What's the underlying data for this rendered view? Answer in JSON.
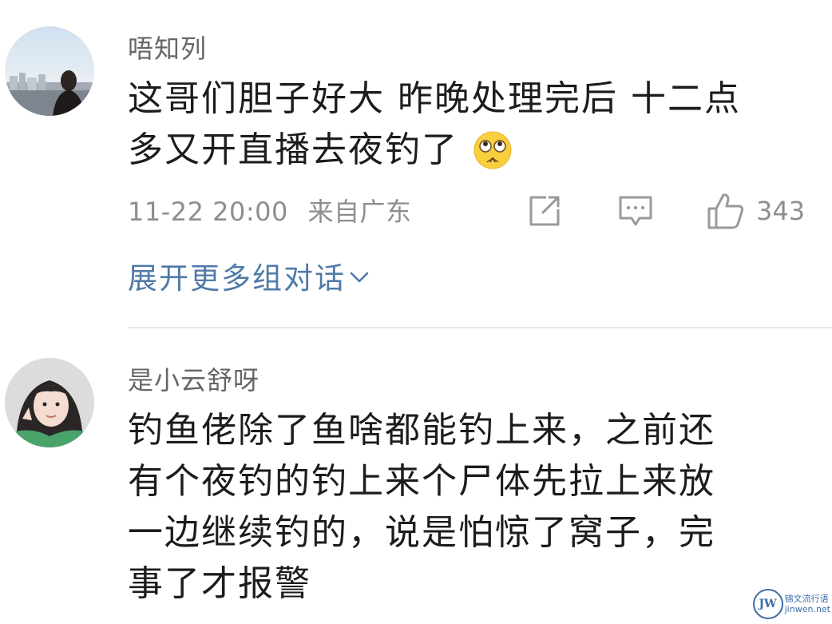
{
  "comments": [
    {
      "username": "唔知列",
      "text_lines": [
        "这哥们胆子好大 昨晚处理完后 十二点",
        "多又开直播去夜钓了"
      ],
      "emoji": "flushed-face-emoji",
      "timestamp": "11-22 20:00",
      "location": "来自广东",
      "like_count": "343",
      "expand_label": "展开更多组对话"
    },
    {
      "username": "是小云舒呀",
      "text_lines": [
        "钓鱼佬除了鱼啥都能钓上来，之前还",
        "有个夜钓的钓上来个尸体先拉上来放",
        "一边继续钓的，说是怕惊了窝子，完",
        "事了才报警"
      ]
    }
  ],
  "watermark": {
    "logo": "JW",
    "line1": "锦文流行语",
    "line2": "jinwen.net"
  },
  "colors": {
    "link": "#4f7aa8",
    "meta": "#8e8e8e",
    "icon": "#9a9a9a"
  },
  "icons": [
    "share-icon",
    "reply-icon",
    "like-icon",
    "chevron-down-icon"
  ]
}
